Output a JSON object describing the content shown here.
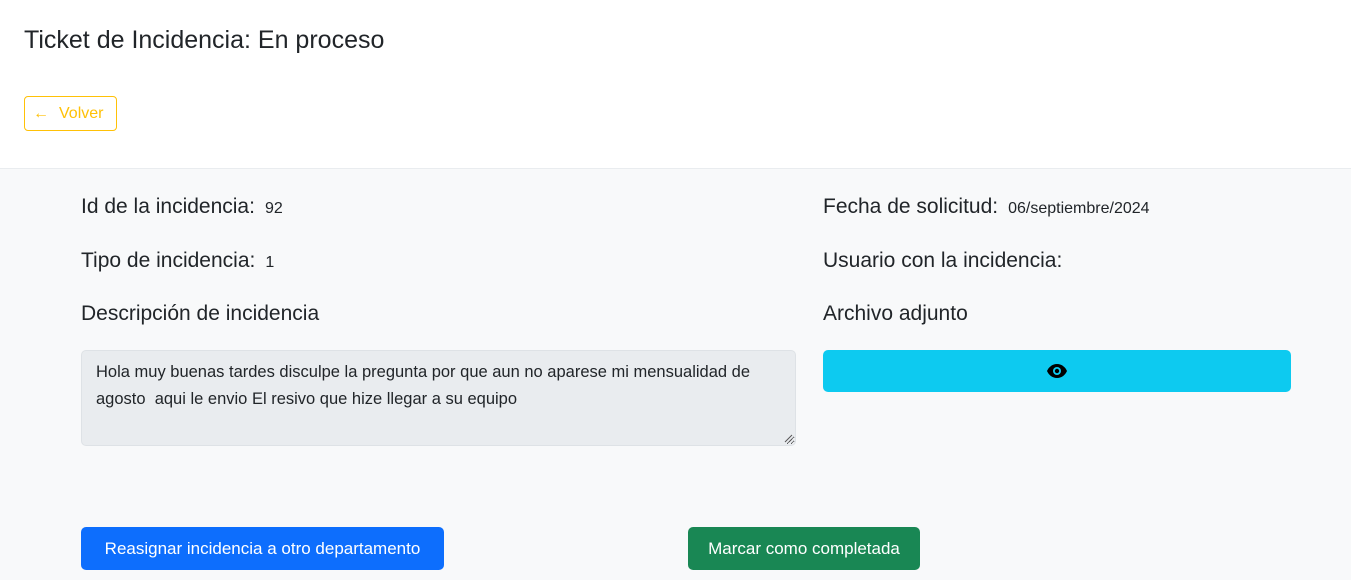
{
  "header": {
    "title": "Ticket de Incidencia: En proceso",
    "back_label": "Volver"
  },
  "details": {
    "id_label": "Id de la incidencia:",
    "id_value": "92",
    "tipo_label": "Tipo de incidencia:",
    "tipo_value": "1",
    "fecha_label": "Fecha de solicitud:",
    "fecha_value": "06/septiembre/2024",
    "usuario_label": "Usuario con la incidencia:",
    "usuario_value": ""
  },
  "description": {
    "label": "Descripción de incidencia",
    "text": "Hola muy buenas tardes disculpe la pregunta por que aun no aparese mi mensualidad de agosto  aqui le envio El resivo que hize llegar a su equipo"
  },
  "attachment": {
    "label": "Archivo adjunto",
    "icon": "eye-icon"
  },
  "actions": {
    "reassign_label": "Reasignar incidencia a otro departamento",
    "complete_label": "Marcar como completada"
  },
  "colors": {
    "warning": "#ffc107",
    "info": "#0dcaf0",
    "primary": "#0d6efd",
    "success": "#198754"
  }
}
